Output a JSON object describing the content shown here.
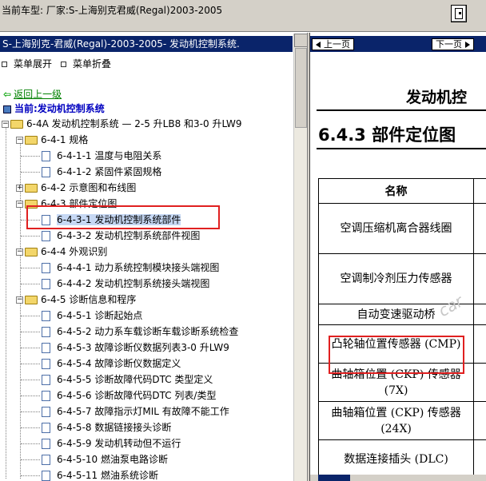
{
  "top_bar": {
    "title": "当前车型:  厂家:S-上海别克君威(Regal)2003-2005",
    "exit_icon": "door-exit-icon"
  },
  "tree_panel": {
    "header": "S-上海别克-君威(Regal)-2003-2005- 发动机控制系统.",
    "expand_all": "菜单展开",
    "collapse_all": "菜单折叠",
    "back_link": "返回上一级",
    "current": "当前:发动机控制系统",
    "root": "6-4A 发动机控制系统 — 2-5 升LB8 和3-0 升LW9",
    "items": [
      {
        "level": 1,
        "type": "folder",
        "expander": "−",
        "label": "6-4-1 规格"
      },
      {
        "level": 2,
        "type": "doc",
        "label": "6-4-1-1 温度与电阻关系"
      },
      {
        "level": 2,
        "type": "doc",
        "label": "6-4-1-2 紧固件紧固规格"
      },
      {
        "level": 1,
        "type": "folder",
        "expander": "+",
        "label": "6-4-2 示意图和布线图"
      },
      {
        "level": 1,
        "type": "folder",
        "expander": "−",
        "label": "6-4-3 部件定位图"
      },
      {
        "level": 2,
        "type": "doc",
        "label": "6-4-3-1 发动机控制系统部件",
        "selected": true
      },
      {
        "level": 2,
        "type": "doc",
        "label": "6-4-3-2 发动机控制系统部件视图"
      },
      {
        "level": 1,
        "type": "folder",
        "expander": "−",
        "label": "6-4-4 外观识别"
      },
      {
        "level": 2,
        "type": "doc",
        "label": "6-4-4-1 动力系统控制模块接头端视图"
      },
      {
        "level": 2,
        "type": "doc",
        "label": "6-4-4-2 发动机控制系统接头端视图"
      },
      {
        "level": 1,
        "type": "folder",
        "expander": "−",
        "label": "6-4-5 诊断信息和程序"
      },
      {
        "level": 2,
        "type": "doc",
        "label": "6-4-5-1 诊断起始点"
      },
      {
        "level": 2,
        "type": "doc",
        "label": "6-4-5-2 动力系车载诊断车载诊断系统检查"
      },
      {
        "level": 2,
        "type": "doc",
        "label": "6-4-5-3 故障诊断仪数据列表3-0 升LW9"
      },
      {
        "level": 2,
        "type": "doc",
        "label": "6-4-5-4 故障诊断仪数据定义"
      },
      {
        "level": 2,
        "type": "doc",
        "label": "6-4-5-5 诊断故障代码DTC 类型定义"
      },
      {
        "level": 2,
        "type": "doc",
        "label": "6-4-5-6 诊断故障代码DTC 列表/类型"
      },
      {
        "level": 2,
        "type": "doc",
        "label": "6-4-5-7 故障指示灯MIL 有故障不能工作"
      },
      {
        "level": 2,
        "type": "doc",
        "label": "6-4-5-8 数据链接接头诊断"
      },
      {
        "level": 2,
        "type": "doc",
        "label": "6-4-5-9 发动机转动但不运行"
      },
      {
        "level": 2,
        "type": "doc",
        "label": "6-4-5-10 燃油泵电路诊断"
      },
      {
        "level": 2,
        "type": "doc",
        "label": "6-4-5-11 燃油系统诊断"
      }
    ]
  },
  "doc_panel": {
    "prev_label": "上一页",
    "next_label": "下一页",
    "heading": "发动机控",
    "section": "6.4.3 部件定位图",
    "table_header": "名称",
    "rows": [
      {
        "name": "空调压缩机离合器线圈"
      },
      {
        "name": "空调制冷剂压力传感器"
      },
      {
        "name": "自动变速驱动桥"
      },
      {
        "name": "凸轮轴位置传感器 (CMP)",
        "highlighted": true
      },
      {
        "name": "曲轴箱位置 (CKP) 传感器 (7X)"
      },
      {
        "name": "曲轴箱位置 (CKP) 传感器 (24X)"
      },
      {
        "name": "数据连接插头 (DLC)"
      }
    ],
    "watermark": "car"
  },
  "colors": {
    "header_bg": "#0a246a",
    "highlight_box": "#e02020",
    "link_green": "#008000",
    "current_blue": "#0000c0"
  }
}
